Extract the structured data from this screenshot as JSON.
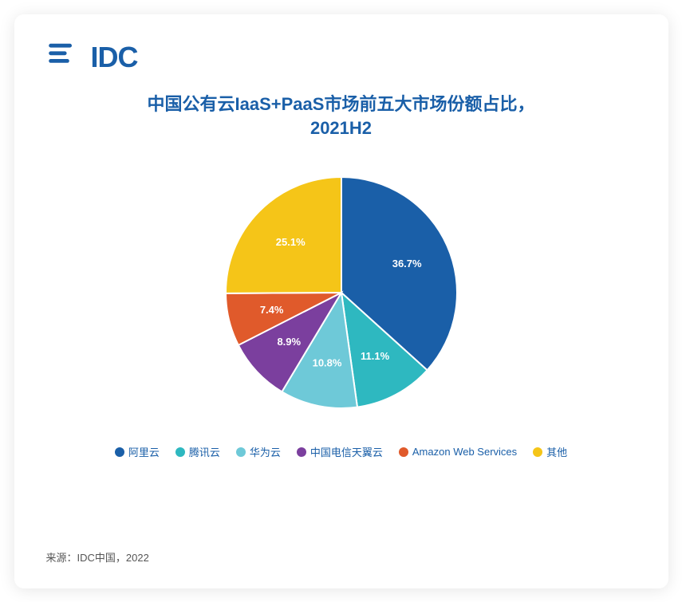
{
  "logo": {
    "text": "IDC",
    "alt": "IDC Logo"
  },
  "title": {
    "line1": "中国公有云IaaS+PaaS市场前五大市场份额占比，",
    "line2": "2021H2"
  },
  "chart": {
    "slices": [
      {
        "label": "阿里云",
        "value": 36.7,
        "color": "#1a5fa8",
        "textAngle": -30
      },
      {
        "label": "腾讯云",
        "value": 11.1,
        "color": "#2eb8c0",
        "textAngle": 60
      },
      {
        "label": "华为云",
        "value": 10.8,
        "color": "#6ec9d8",
        "textAngle": 140
      },
      {
        "label": "中国电信天翼云",
        "value": 8.9,
        "color": "#7b3f9e",
        "textAngle": 200
      },
      {
        "label": "Amazon Web Services",
        "value": 7.4,
        "color": "#e05a2b",
        "textAngle": 235
      },
      {
        "label": "其他",
        "value": 25.1,
        "color": "#f5c518",
        "textAngle": 305
      }
    ]
  },
  "legend": [
    {
      "label": "阿里云",
      "color": "#1a5fa8"
    },
    {
      "label": "腾讯云",
      "color": "#2eb8c0"
    },
    {
      "label": "华为云",
      "color": "#6ec9d8"
    },
    {
      "label": "中国电信天翼云",
      "color": "#7b3f9e"
    },
    {
      "label": "Amazon Web Services",
      "color": "#e05a2b"
    },
    {
      "label": "其他",
      "color": "#f5c518"
    }
  ],
  "source": "来源：IDC中国，2022"
}
